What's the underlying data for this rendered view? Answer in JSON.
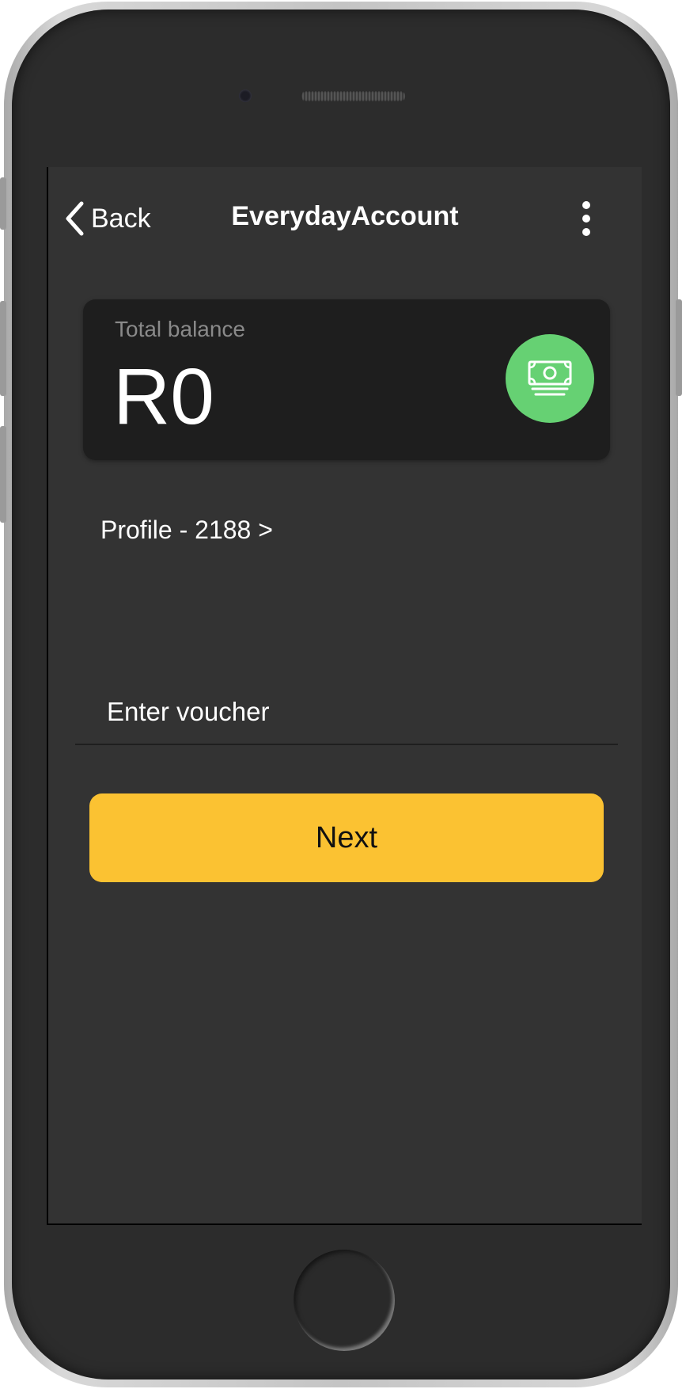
{
  "header": {
    "back_label": "Back",
    "title": "EverydayAccount"
  },
  "balance": {
    "label": "Total balance",
    "amount": "R0"
  },
  "profile": {
    "link_label": "Profile - 2188 >"
  },
  "voucher": {
    "placeholder": "Enter voucher",
    "value": ""
  },
  "actions": {
    "next_label": "Next"
  },
  "icons": {
    "back": "chevron-left-icon",
    "more": "more-vertical-icon",
    "cash": "cash-icon"
  },
  "colors": {
    "screen_bg": "#333333",
    "card_bg": "#1e1e1e",
    "accent_green": "#66d173",
    "button_yellow": "#fbc232"
  }
}
